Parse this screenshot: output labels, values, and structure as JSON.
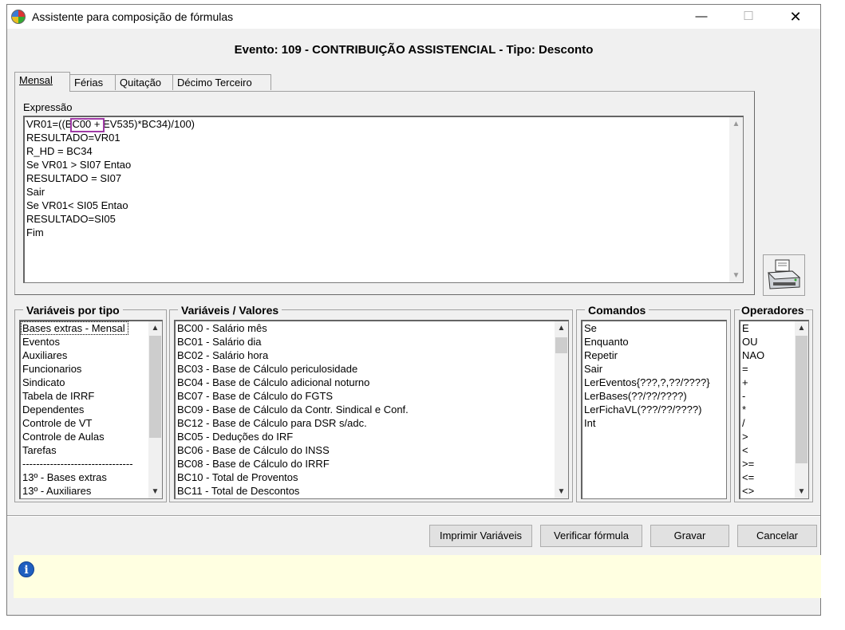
{
  "window": {
    "title": "Assistente para composição de fórmulas",
    "minimize": "—",
    "maximize": "☐",
    "close": "✕"
  },
  "header": "Evento: 109 - CONTRIBUIÇÃO ASSISTENCIAL - Tipo: Desconto",
  "tabs": [
    "Mensal",
    "Férias",
    "Quitação",
    "Décimo Terceiro"
  ],
  "expression": {
    "label": "Expressão",
    "lines": [
      "VR01=((BC00 + EV535)*BC34)/100)",
      "RESULTADO=VR01",
      "R_HD = BC34",
      "Se VR01 > SI07 Entao",
      "RESULTADO = SI07",
      "Sair",
      "Se VR01< SI05 Entao",
      "RESULTADO=SI05",
      "Fim"
    ]
  },
  "groups": {
    "tipos": {
      "label": "Variáveis por tipo",
      "items": [
        "Bases extras - Mensal",
        "Eventos",
        "Auxiliares",
        "Funcionarios",
        "Sindicato",
        "Tabela de IRRF",
        "Dependentes",
        "Controle de VT",
        "Controle de Aulas",
        "Tarefas",
        "--------------------------------",
        "13º - Bases extras",
        "13º - Auxiliares"
      ]
    },
    "valores": {
      "label": "Variáveis / Valores",
      "items": [
        "BC00 - Salário mês",
        "BC01 - Salário dia",
        "BC02 - Salário hora",
        "BC03 - Base de Cálculo periculosidade",
        "BC04 - Base de Cálculo adicional noturno",
        "BC07 - Base de Cálculo do FGTS",
        "BC09 - Base de Cálculo da Contr. Sindical e Conf.",
        "BC12 - Base de Cálculo para DSR s/adc.",
        "BC05 - Deduções do IRF",
        "BC06 - Base de Cálculo do INSS",
        "BC08 - Base de Cálculo do IRRF",
        "BC10 - Total de Proventos",
        "BC11 - Total de Descontos"
      ]
    },
    "comandos": {
      "label": "Comandos",
      "items": [
        "Se",
        "Enquanto",
        "Repetir",
        "Sair",
        "LerEventos{???,?,??/????}",
        "LerBases(??/??/????)",
        "LerFichaVL(???/??/????)",
        "Int"
      ]
    },
    "operadores": {
      "label": "Operadores",
      "items": [
        "E",
        "OU",
        "NAO",
        "=",
        "+",
        "-",
        "*",
        "/",
        ">",
        "<",
        ">=",
        "<=",
        "<>"
      ]
    }
  },
  "buttons": {
    "imprimir": "Imprimir Variáveis",
    "verificar": "Verificar fórmula",
    "gravar": "Gravar",
    "cancelar": "Cancelar"
  },
  "status": {
    "icon": "info-icon"
  },
  "colors": {
    "highlight": "#a03aa6",
    "status_bg": "#ffffe1",
    "info_blue": "#1f5fc0"
  }
}
